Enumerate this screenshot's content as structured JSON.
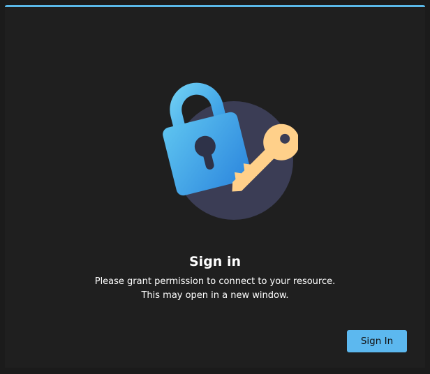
{
  "dialog": {
    "title": "Sign in",
    "message": "Please grant permission to connect to your resource. This may open in a new window.",
    "sign_in_label": "Sign In"
  },
  "colors": {
    "accent": "#5cb8ef",
    "background": "#1f1f1f",
    "lock": "#3a9be2",
    "key": "#ffd08a",
    "circle": "#3b3d55"
  },
  "icons": {
    "illustration": "lock-and-key-icon"
  }
}
